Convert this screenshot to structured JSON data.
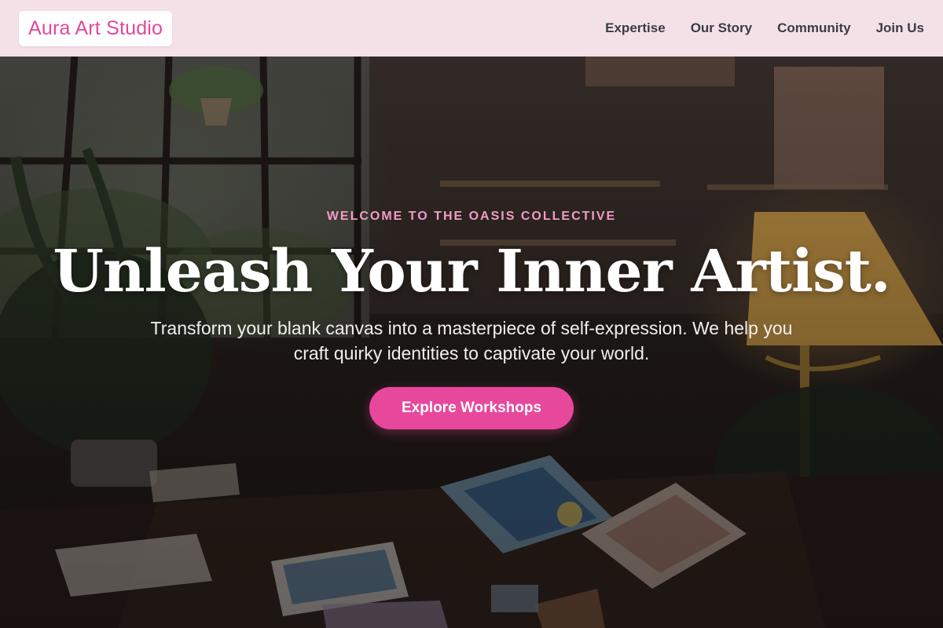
{
  "brand": {
    "name": "Aura Art Studio"
  },
  "nav": {
    "items": [
      {
        "label": "Expertise"
      },
      {
        "label": "Our Story"
      },
      {
        "label": "Community"
      },
      {
        "label": "Join Us"
      }
    ]
  },
  "hero": {
    "eyebrow": "WELCOME TO THE OASIS COLLECTIVE",
    "headline": "Unleash Your Inner Artist.",
    "subtext": "Transform your blank canvas into a masterpiece of self-expression. We help you craft quirky identities to captivate your world.",
    "cta_label": "Explore Workshops",
    "background_icon": "art-studio-photo"
  },
  "colors": {
    "accent": "#e8489b",
    "eyebrow": "#f19cc7",
    "nav_bg": "#f4e1e8",
    "nav_text": "#3b3b46"
  }
}
